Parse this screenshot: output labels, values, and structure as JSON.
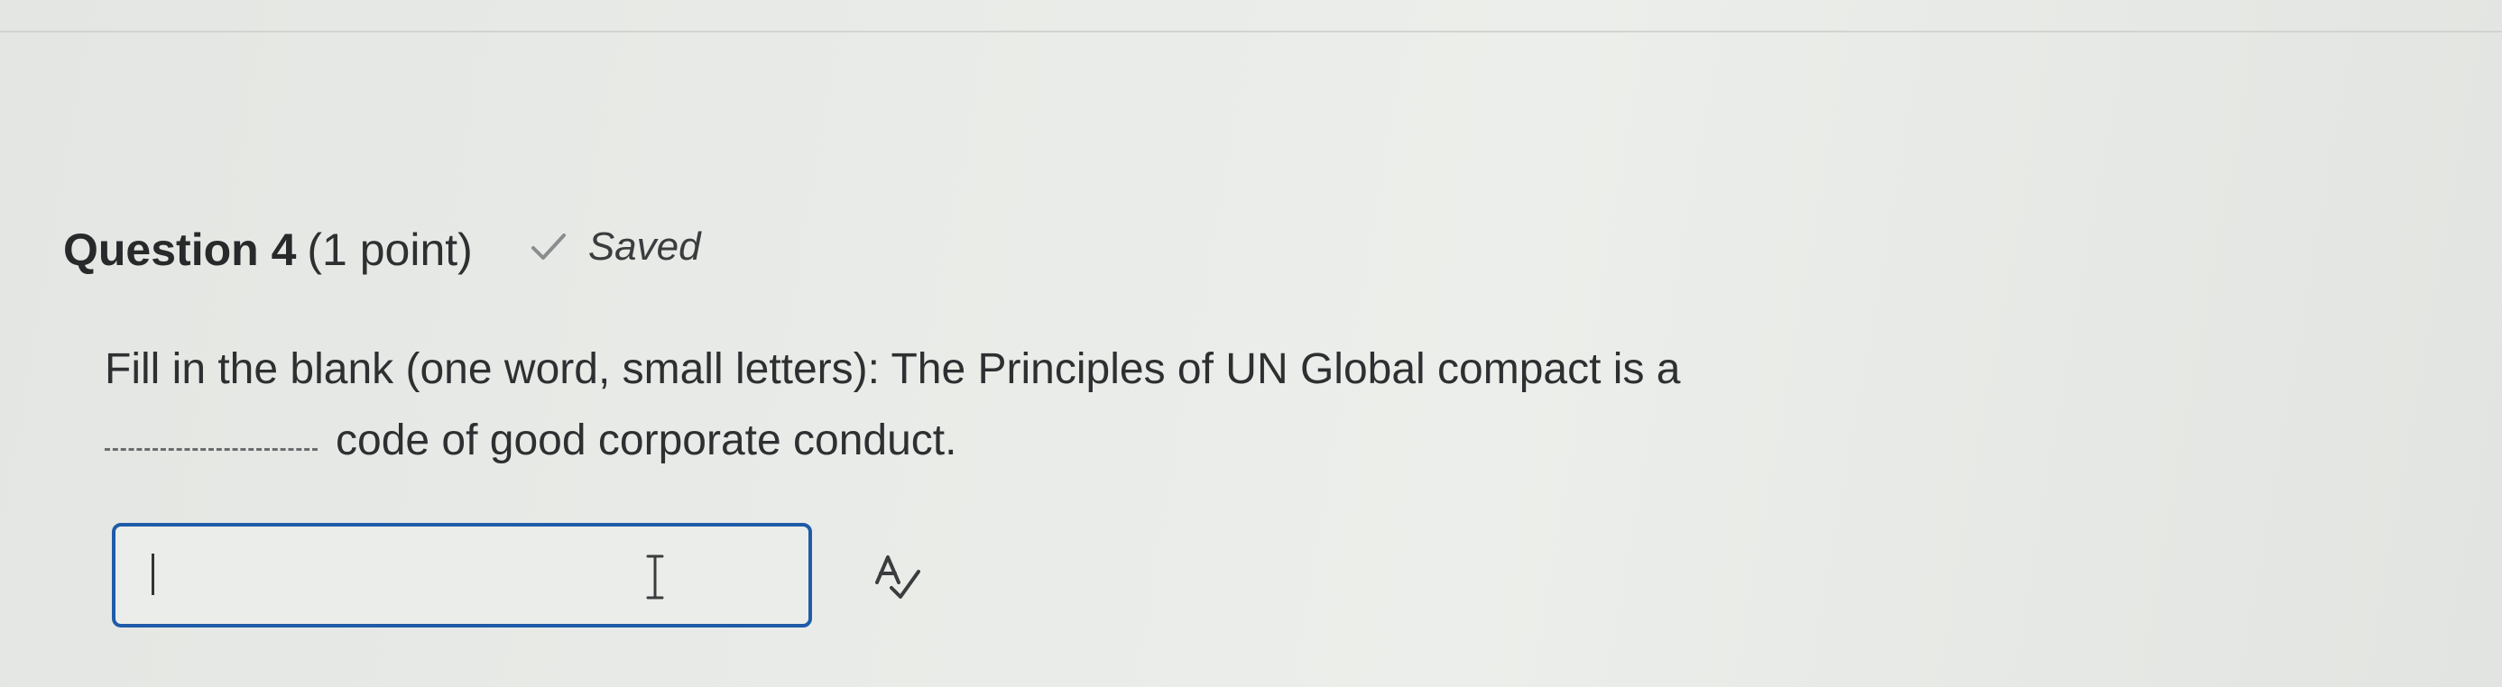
{
  "question": {
    "title": "Question 4",
    "points": "(1 point)",
    "status": "Saved",
    "text_before_blank": "Fill in the blank (one word, small letters): The Principles of UN Global compact is a",
    "text_after_blank": "code of good corporate conduct."
  },
  "answer": {
    "value": ""
  },
  "icons": {
    "saved": "check-icon",
    "cursor": "text-cursor-icon",
    "spell_check": "spell-check-icon"
  },
  "colors": {
    "field_border": "#1f5ba8",
    "check": "#8a8c8e"
  }
}
